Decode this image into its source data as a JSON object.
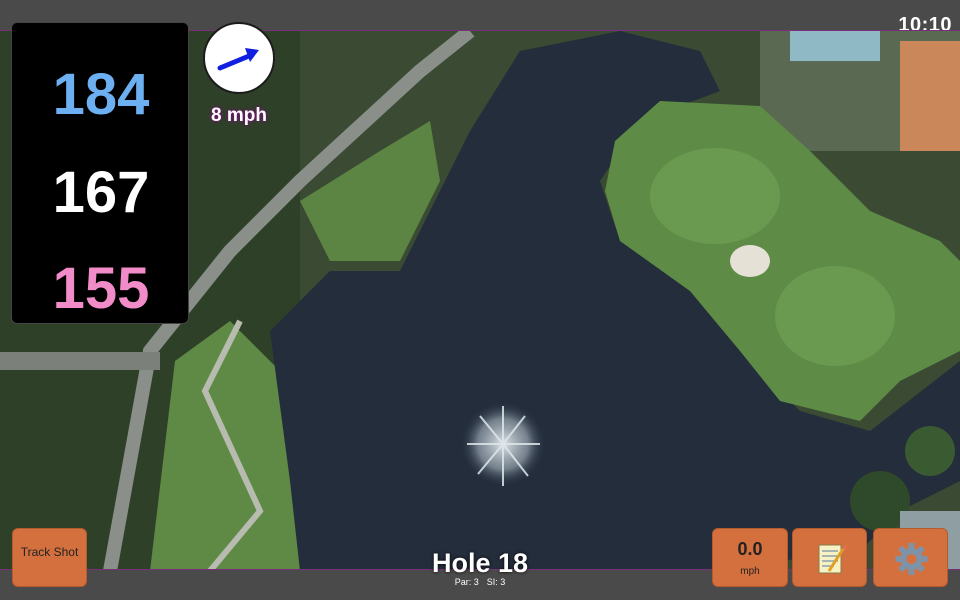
{
  "status": {
    "time": "10:10"
  },
  "yardages": {
    "back": "184",
    "middle": "167",
    "front": "155"
  },
  "wind": {
    "speed": "8 mph",
    "direction_icon": "wind-arrow-icon"
  },
  "hole": {
    "title": "Hole 18",
    "par": "Par: 3",
    "si": "SI: 3"
  },
  "buttons": {
    "track_shot": "Track Shot",
    "speed_value": "0.0",
    "speed_unit": "mph",
    "notes_icon": "notepad-icon",
    "settings_icon": "gear-icon"
  },
  "colors": {
    "back_yardage": "#6cb0f2",
    "middle_yardage": "#ffffff",
    "front_yardage": "#f28cc9",
    "button_bg": "#d4703e",
    "wind_arrow": "#1020e0"
  }
}
